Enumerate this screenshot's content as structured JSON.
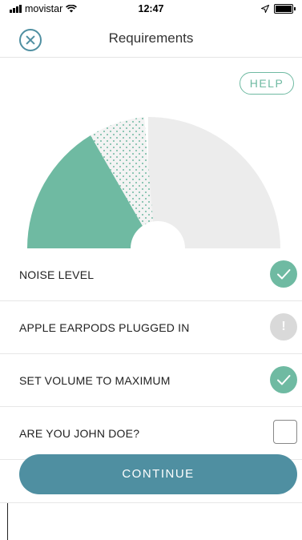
{
  "status_bar": {
    "carrier": "movistar",
    "time": "12:47",
    "icons": [
      "signal-icon",
      "wifi-icon",
      "location-arrow-icon",
      "battery-icon"
    ]
  },
  "header": {
    "title": "Requirements",
    "close_icon": "close-icon"
  },
  "help": {
    "label": "HELP"
  },
  "gauge": {
    "colors": {
      "filled": "#6fbaa2",
      "dotted": "#6fbaa2",
      "background": "#ececec"
    }
  },
  "requirements": [
    {
      "label": "NOISE LEVEL",
      "state": "done",
      "icon": "check-icon"
    },
    {
      "label": "APPLE EARPODS PLUGGED IN",
      "state": "warning",
      "icon": "exclamation-icon",
      "glyph": "!"
    },
    {
      "label": "SET VOLUME TO MAXIMUM",
      "state": "done",
      "icon": "check-icon"
    },
    {
      "label": "ARE YOU JOHN DOE?",
      "state": "unchecked",
      "icon": "checkbox-icon"
    }
  ],
  "continue_button": {
    "label": "CONTINUE"
  },
  "colors": {
    "accent": "#6fbaa2",
    "button": "#4f8fa1",
    "divider": "#e7e7e7",
    "warning": "#d9d9d9"
  }
}
